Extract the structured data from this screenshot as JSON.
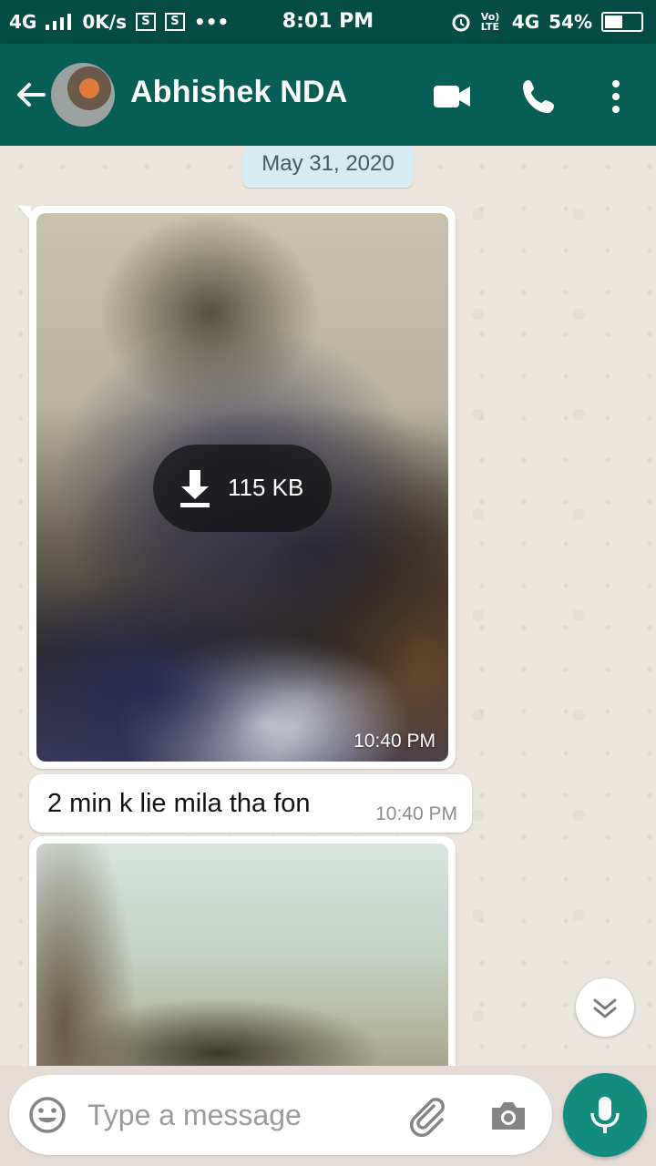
{
  "status_bar": {
    "network": "4G",
    "speed": "0K/s",
    "sim_icon_1": "S",
    "sim_icon_2": "S",
    "dots": "•••",
    "time": "8:01 PM",
    "volte": "Vo) LTE",
    "network_right": "4G",
    "battery": "54%",
    "battery_level": 0.54
  },
  "header": {
    "contact_name": "Abhishek NDA",
    "icons": [
      "back-arrow-icon",
      "video-call-icon",
      "phone-call-icon",
      "more-vert-icon"
    ]
  },
  "chat": {
    "date_chip": "May 31, 2020",
    "messages": [
      {
        "type": "image",
        "download_size": "115 KB",
        "time": "10:40 PM"
      },
      {
        "type": "text",
        "text": "2 min k lie mila tha fon",
        "time": "10:40 PM"
      },
      {
        "type": "image"
      }
    ]
  },
  "composer": {
    "placeholder": "Type a message",
    "icons": [
      "emoji-icon",
      "attach-icon",
      "camera-icon",
      "mic-icon"
    ]
  },
  "colors": {
    "header": "#075e54",
    "status_bar": "#054d44",
    "accent": "#128c7e",
    "date_chip": "#d5ecf4"
  }
}
